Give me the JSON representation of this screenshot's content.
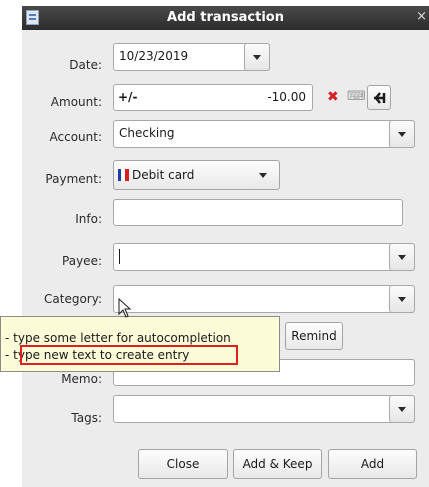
{
  "window": {
    "title": "Add transaction",
    "close_glyph": "×"
  },
  "labels": {
    "date": "Date:",
    "amount": "Amount:",
    "account": "Account:",
    "payment": "Payment:",
    "info": "Info:",
    "payee": "Payee:",
    "category": "Category:",
    "memo": "Memo:",
    "tags": "Tags:"
  },
  "fields": {
    "date": "10/23/2019",
    "amount_sign": "+/-",
    "amount": "-10.00",
    "account": "Checking",
    "payment": "Debit card",
    "info": "",
    "payee": "",
    "category": "",
    "memo": "",
    "tags": ""
  },
  "buttons": {
    "remind": "Remind",
    "close": "Close",
    "add_keep": "Add & Keep",
    "add": "Add"
  },
  "tooltip": {
    "line1": "- type some letter for autocompletion",
    "line2": "- type new text to create entry"
  },
  "colors": {
    "highlight": "#e02020",
    "clear_icon": "#d42020",
    "flag_blue": "#1f3fa6",
    "flag_red": "#d42020"
  }
}
